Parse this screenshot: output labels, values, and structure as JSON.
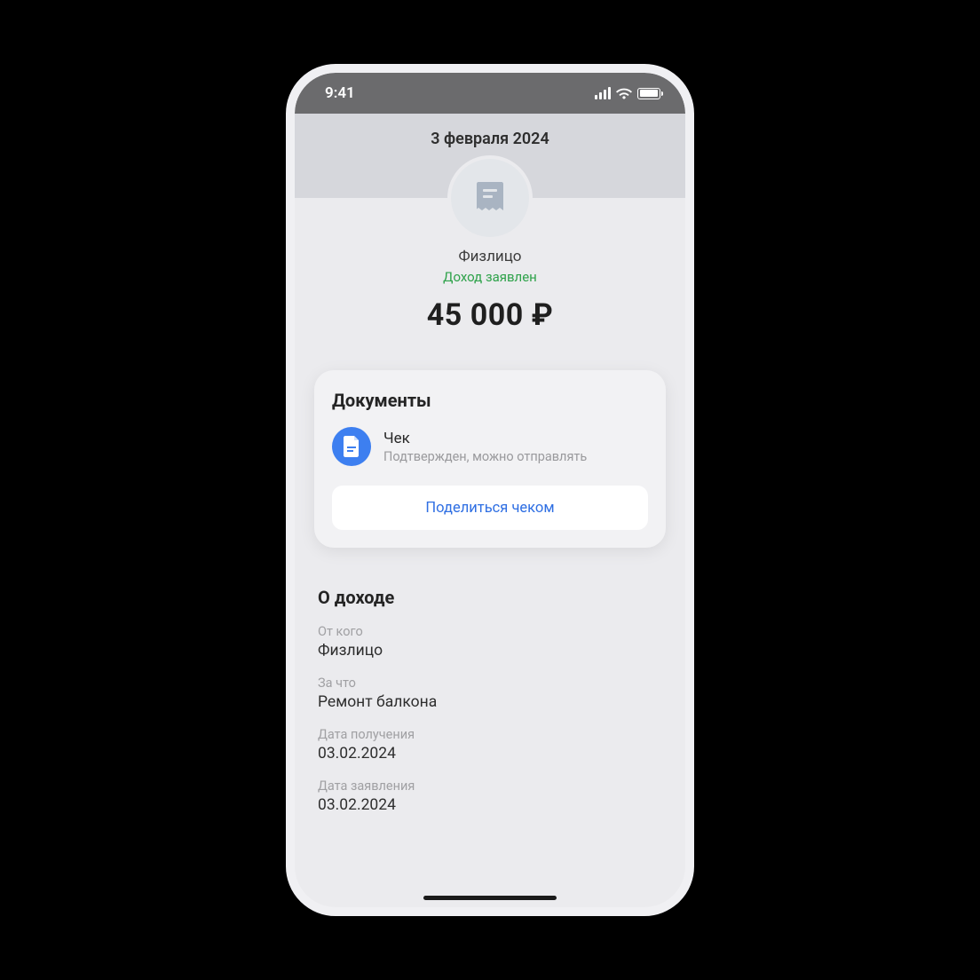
{
  "statusbar": {
    "time": "9:41"
  },
  "header": {
    "date": "3 февраля 2024"
  },
  "summary": {
    "label": "Физлицо",
    "status": "Доход заявлен",
    "amount": "45 000 ₽"
  },
  "documents": {
    "title": "Документы",
    "item": {
      "title": "Чек",
      "subtitle": "Подтвержден, можно отправлять"
    },
    "share_label": "Поделиться чеком"
  },
  "about": {
    "title": "О доходе",
    "fields": [
      {
        "label": "От кого",
        "value": "Физлицо"
      },
      {
        "label": "За что",
        "value": "Ремонт балкона"
      },
      {
        "label": "Дата получения",
        "value": "03.02.2024"
      },
      {
        "label": "Дата заявления",
        "value": "03.02.2024"
      }
    ]
  }
}
